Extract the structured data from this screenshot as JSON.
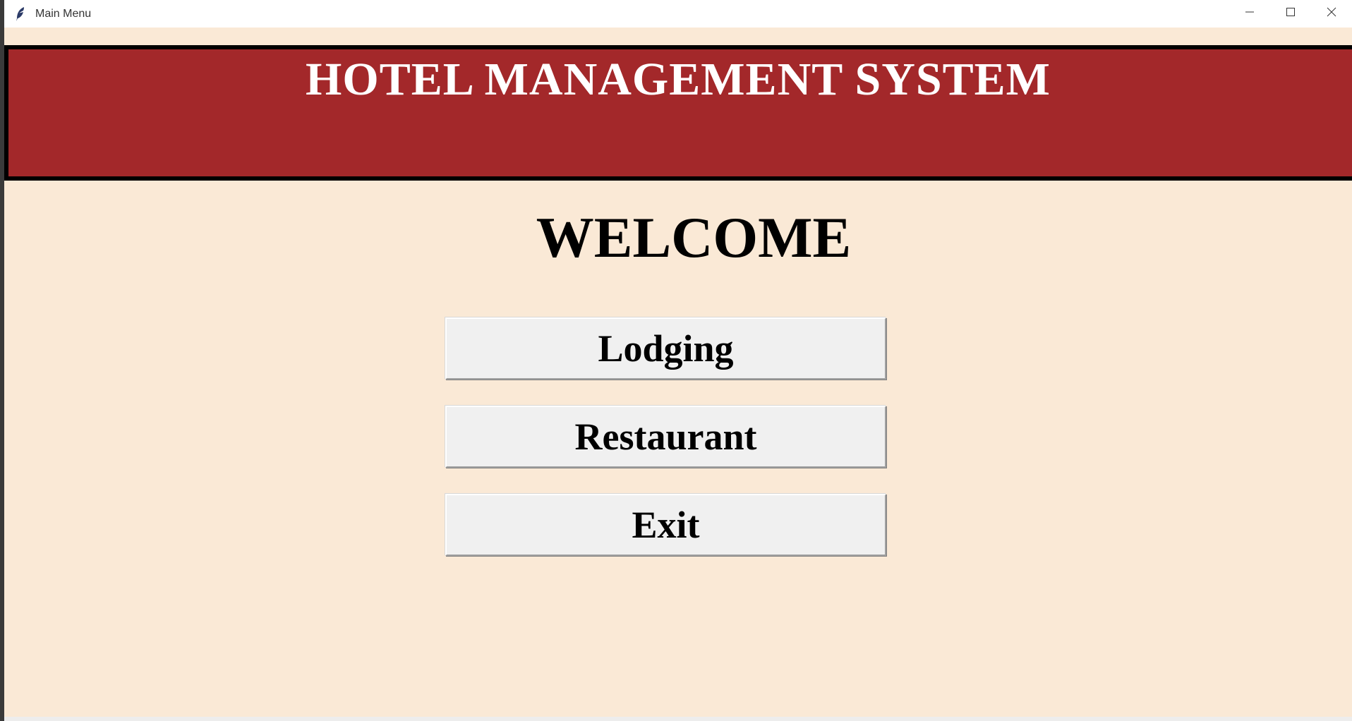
{
  "window": {
    "title": "Main Menu",
    "app_icon": "feather-icon",
    "controls": [
      "minimize-icon",
      "maximize-icon",
      "close-icon"
    ]
  },
  "header": {
    "title": "HOTEL MANAGEMENT SYSTEM"
  },
  "main": {
    "welcome": "WELCOME",
    "buttons": [
      {
        "label": "Lodging"
      },
      {
        "label": "Restaurant"
      },
      {
        "label": "Exit"
      }
    ]
  },
  "colors": {
    "background": "#fae9d6",
    "banner": "#a3282a",
    "banner_border": "#000000",
    "button_face": "#f0f0f0"
  }
}
